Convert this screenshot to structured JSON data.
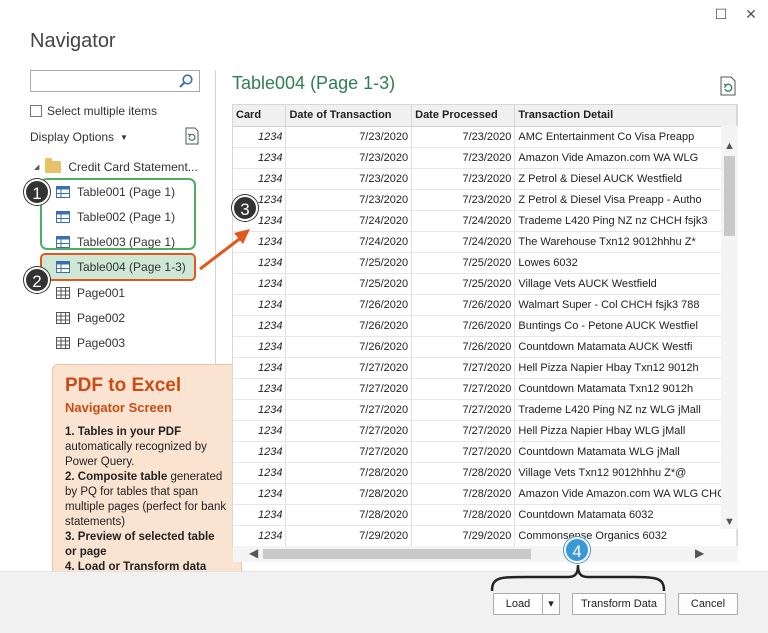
{
  "window": {
    "title": "Navigator",
    "maximize_icon": "☐",
    "close_icon": "✕"
  },
  "left_pane": {
    "search": {
      "value": "",
      "placeholder": ""
    },
    "select_multiple_label": "Select multiple items",
    "display_options_label": "Display Options",
    "tree": {
      "root": "Credit Card Statement...",
      "items": [
        {
          "label": "Table001 (Page 1)",
          "type": "table"
        },
        {
          "label": "Table002 (Page 1)",
          "type": "table"
        },
        {
          "label": "Table003 (Page 1)",
          "type": "table"
        },
        {
          "label": "Table004 (Page 1-3)",
          "type": "table",
          "selected": true
        },
        {
          "label": "Page001",
          "type": "page"
        },
        {
          "label": "Page002",
          "type": "page"
        },
        {
          "label": "Page003",
          "type": "page"
        }
      ]
    }
  },
  "badges": [
    "1",
    "2",
    "3",
    "4"
  ],
  "callout": {
    "title": "PDF to Excel",
    "subtitle": "Navigator Screen",
    "p1_bold": "1. Tables in your PDF",
    "p1": " automatically recognized by Power Query.",
    "p2_bold": "2. Composite table",
    "p2": " generated by PQ for tables that span multiple pages (perfect for bank statements)",
    "p3_bold": "3. Preview of selected table or page",
    "p4_bold": "4. Load or Transform data"
  },
  "preview": {
    "title": "Table004 (Page 1-3)",
    "columns": [
      "Card",
      "Date of Transaction",
      "Date Processed",
      "Transaction Detail"
    ],
    "rows": [
      [
        "1234",
        "7/23/2020",
        "7/23/2020",
        "AMC Entertainment Co Visa Preapp"
      ],
      [
        "1234",
        "7/23/2020",
        "7/23/2020",
        "Amazon Vide Amazon.com WA WLG"
      ],
      [
        "1234",
        "7/23/2020",
        "7/23/2020",
        "Z Petrol & Diesel AUCK Westfield"
      ],
      [
        "1234",
        "7/23/2020",
        "7/23/2020",
        "Z Petrol & Diesel Visa Preapp - Autho"
      ],
      [
        "1234",
        "7/24/2020",
        "7/24/2020",
        "Trademe L420 Ping NZ nz CHCH fsjk3"
      ],
      [
        "1234",
        "7/24/2020",
        "7/24/2020",
        "The Warehouse Txn12 9012hhhu Z*"
      ],
      [
        "1234",
        "7/25/2020",
        "7/25/2020",
        "Lowes 6032"
      ],
      [
        "1234",
        "7/25/2020",
        "7/25/2020",
        "Village Vets AUCK Westfield"
      ],
      [
        "1234",
        "7/26/2020",
        "7/26/2020",
        "Walmart Super - Col CHCH fsjk3 788"
      ],
      [
        "1234",
        "7/26/2020",
        "7/26/2020",
        "Buntings Co - Petone AUCK Westfiel"
      ],
      [
        "1234",
        "7/26/2020",
        "7/26/2020",
        "Countdown Matamata AUCK Westfi"
      ],
      [
        "1234",
        "7/27/2020",
        "7/27/2020",
        "Hell Pizza Napier Hbay Txn12 9012h"
      ],
      [
        "1234",
        "7/27/2020",
        "7/27/2020",
        "Countdown Matamata Txn12 9012h"
      ],
      [
        "1234",
        "7/27/2020",
        "7/27/2020",
        "Trademe L420 Ping NZ nz WLG jMall"
      ],
      [
        "1234",
        "7/27/2020",
        "7/27/2020",
        "Hell Pizza Napier Hbay WLG jMall"
      ],
      [
        "1234",
        "7/27/2020",
        "7/27/2020",
        "Countdown Matamata WLG jMall"
      ],
      [
        "1234",
        "7/28/2020",
        "7/28/2020",
        "Village Vets Txn12 9012hhhu Z*@"
      ],
      [
        "1234",
        "7/28/2020",
        "7/28/2020",
        "Amazon Vide Amazon.com WA WLG CHCH"
      ],
      [
        "1234",
        "7/28/2020",
        "7/28/2020",
        "Countdown Matamata 6032"
      ],
      [
        "1234",
        "7/29/2020",
        "7/29/2020",
        "Commonsense Organics 6032"
      ]
    ]
  },
  "footer": {
    "load_label": "Load",
    "dropdown_icon": "▾",
    "transform_label": "Transform Data",
    "cancel_label": "Cancel"
  },
  "colors": {
    "green": "#4caf63",
    "orange": "#e2571c",
    "blue": "#3a97d8",
    "callout_bg": "#fbe3d1",
    "callout_text": "#c94c14",
    "preview_title": "#2f7e55"
  }
}
